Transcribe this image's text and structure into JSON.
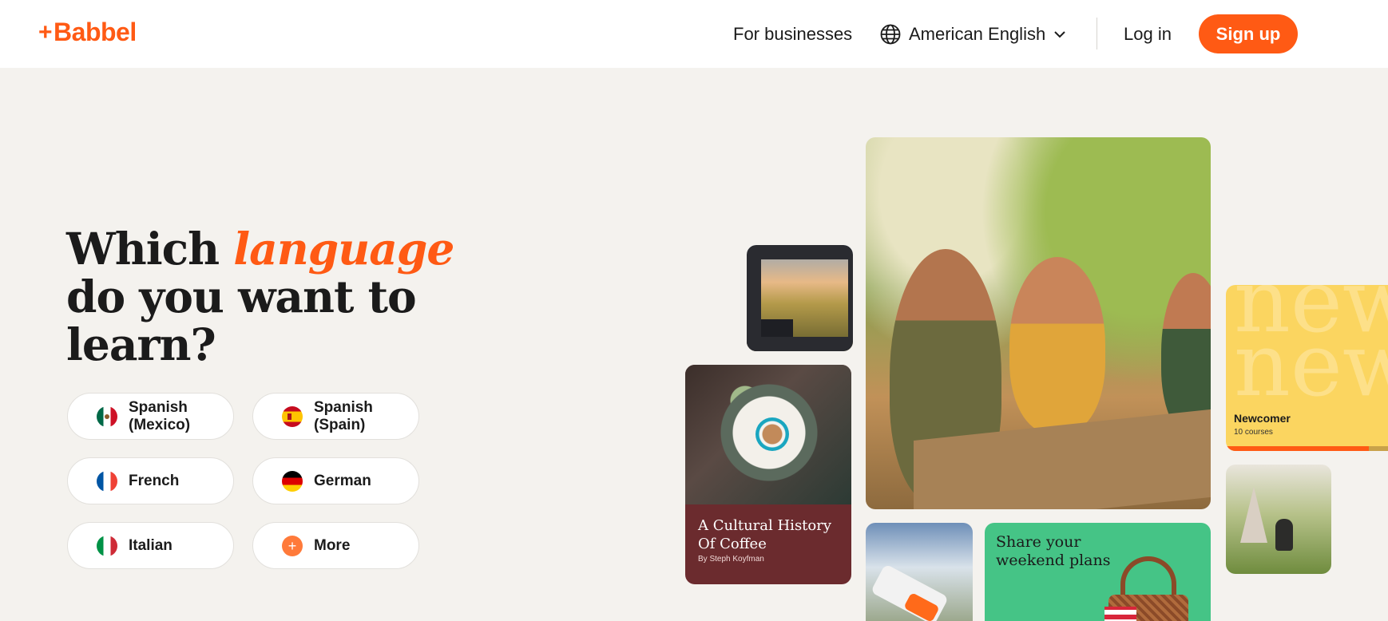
{
  "header": {
    "brand": "Babbel",
    "brand_prefix": "+",
    "for_businesses": "For businesses",
    "language": "American English",
    "login": "Log in",
    "signup": "Sign up"
  },
  "hero": {
    "headline_start": "Which ",
    "headline_accent": "language",
    "headline_line2": "do you want to",
    "headline_line3": "learn?"
  },
  "languages": [
    {
      "label_line1": "Spanish",
      "label_line2": "(Mexico)",
      "flag": "mexico-flag"
    },
    {
      "label_line1": "Spanish",
      "label_line2": "(Spain)",
      "flag": "spain-flag"
    },
    {
      "label_line1": "French",
      "label_line2": "",
      "flag": "france-flag"
    },
    {
      "label_line1": "German",
      "label_line2": "",
      "flag": "germany-flag"
    },
    {
      "label_line1": "Italian",
      "label_line2": "",
      "flag": "italy-flag"
    },
    {
      "label_line1": "More",
      "label_line2": "",
      "flag": "plus-icon"
    }
  ],
  "collage": {
    "coffee_title_line1": "A Cultural History",
    "coffee_title_line2": "Of Coffee",
    "coffee_byline": "By Steph Koyfman",
    "newcomer_big_line1": "new",
    "newcomer_big_line2": "new",
    "newcomer_title": "Newcomer",
    "newcomer_sub": "10 courses",
    "newcomer_progress": 0.85,
    "share_line1": "Share your",
    "share_line2": "weekend plans"
  },
  "colors": {
    "brand": "#ff5a14",
    "background": "#f4f2ee",
    "coffee_card": "#6b2b2e",
    "newcomer_card": "#fbd560",
    "share_card": "#45c486"
  }
}
